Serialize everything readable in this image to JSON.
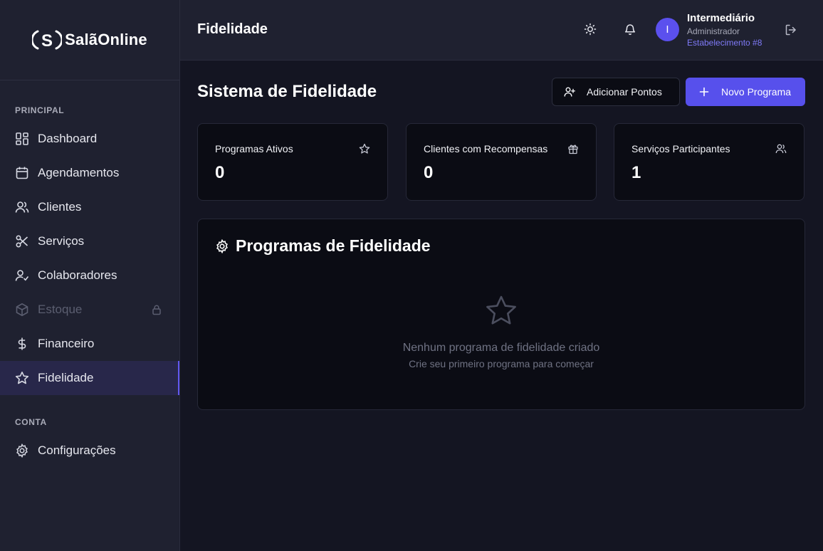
{
  "brand": {
    "logo_symbol": "S",
    "name": "SalãOnline"
  },
  "sidebar": {
    "section_principal": "PRINCIPAL",
    "items": [
      {
        "label": "Dashboard",
        "icon": "dashboard-icon"
      },
      {
        "label": "Agendamentos",
        "icon": "calendar-icon"
      },
      {
        "label": "Clientes",
        "icon": "users-icon"
      },
      {
        "label": "Serviços",
        "icon": "scissors-icon"
      },
      {
        "label": "Colaboradores",
        "icon": "user-check-icon"
      },
      {
        "label": "Estoque",
        "icon": "package-icon",
        "disabled": true,
        "locked": true
      },
      {
        "label": "Financeiro",
        "icon": "dollar-icon"
      },
      {
        "label": "Fidelidade",
        "icon": "star-icon",
        "active": true
      }
    ],
    "section_conta": "CONTA",
    "conta_items": [
      {
        "label": "Configurações",
        "icon": "gear-icon"
      }
    ]
  },
  "header": {
    "title": "Fidelidade",
    "user": {
      "avatar_letter": "I",
      "name": "Intermediário",
      "role": "Administrador",
      "establishment": "Estabelecimento #8"
    }
  },
  "main": {
    "title": "Sistema de Fidelidade",
    "add_points_label": "Adicionar Pontos",
    "new_program_label": "Novo Programa",
    "stats": [
      {
        "label": "Programas Ativos",
        "value": "0",
        "icon": "star-icon"
      },
      {
        "label": "Clientes com Recompensas",
        "value": "0",
        "icon": "gift-icon"
      },
      {
        "label": "Serviços Participantes",
        "value": "1",
        "icon": "users-icon"
      }
    ],
    "programs_panel": {
      "title": "Programas de Fidelidade",
      "empty_title": "Nenhum programa de fidelidade criado",
      "empty_subtitle": "Crie seu primeiro programa para começar"
    }
  },
  "colors": {
    "accent": "#5750ec",
    "background": "#141522",
    "sidebar": "#1f2130",
    "card": "#0b0c14"
  }
}
